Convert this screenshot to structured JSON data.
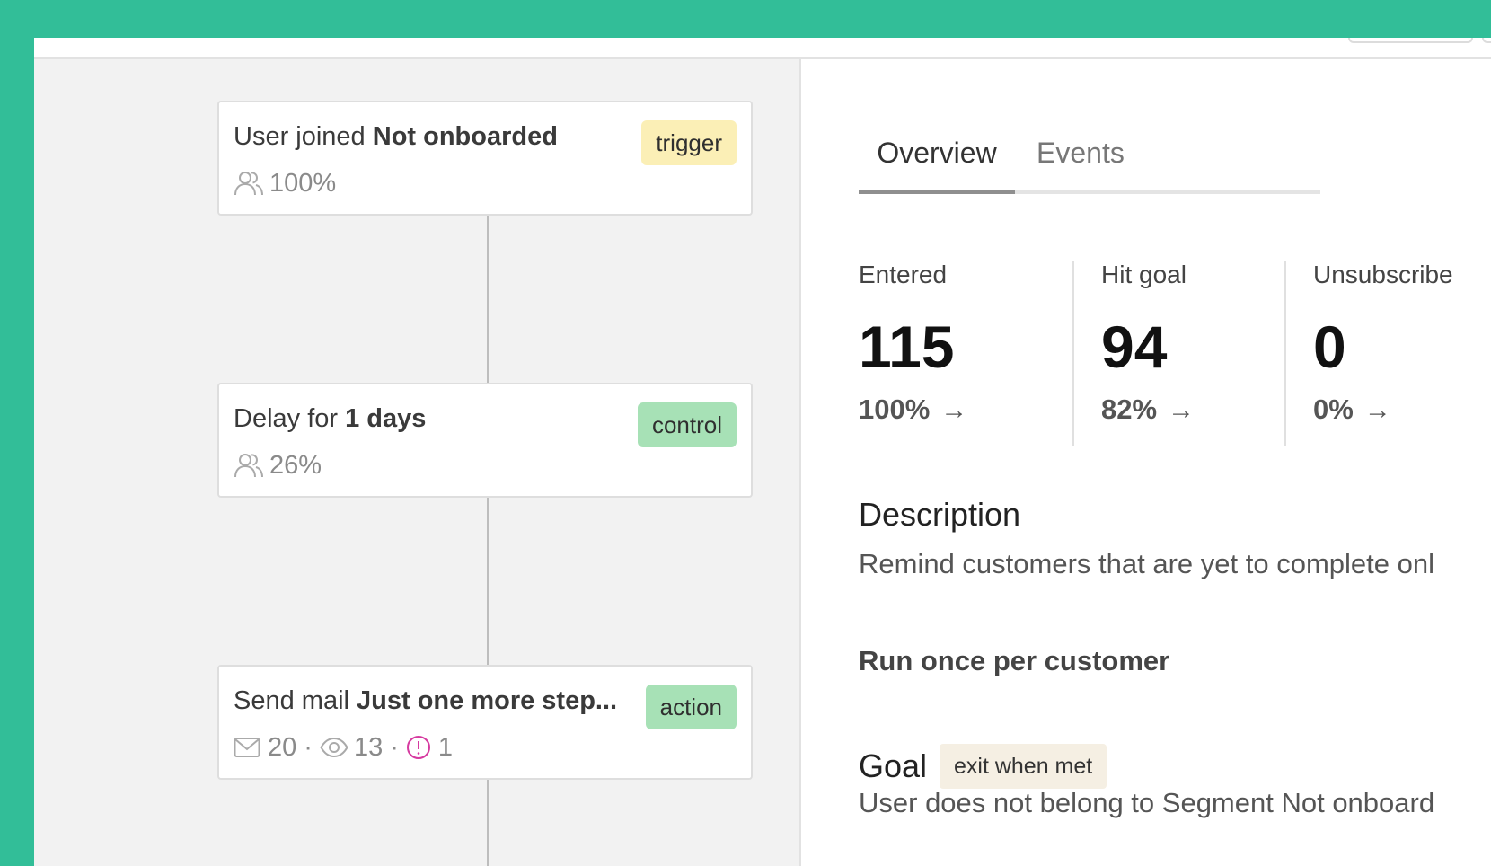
{
  "workflow": {
    "nodes": [
      {
        "prefix": "User joined",
        "name": "Not onboarded",
        "tag": "trigger",
        "icon": "users-icon",
        "percent": "100%"
      },
      {
        "prefix": "Delay for",
        "name": "1 days",
        "tag": "control",
        "icon": "users-icon",
        "percent": "26%"
      },
      {
        "prefix": "Send mail",
        "name": "Just one more step...",
        "tag": "action",
        "stats": {
          "sent": "20",
          "opened": "13",
          "errors": "1",
          "separator": "·"
        }
      }
    ]
  },
  "panel": {
    "tabs": [
      {
        "label": "Overview",
        "active": true
      },
      {
        "label": "Events",
        "active": false
      }
    ],
    "stats": [
      {
        "label": "Entered",
        "value": "115",
        "percent": "100%",
        "arrow": "→"
      },
      {
        "label": "Hit goal",
        "value": "94",
        "percent": "82%",
        "arrow": "→"
      },
      {
        "label": "Unsubscribe",
        "value": "0",
        "percent": "0%",
        "arrow": "→"
      }
    ],
    "description": {
      "title": "Description",
      "text": "Remind customers that are yet to complete onl"
    },
    "run_once": "Run once per customer",
    "goal": {
      "title": "Goal",
      "tag": "exit when met",
      "text": "User does not belong to Segment Not onboard"
    }
  },
  "colors": {
    "accent": "#32be98",
    "trigger_tag": "#fbefb6",
    "control_tag": "#a7e1b6",
    "action_tag": "#a7e1b6",
    "error_icon": "#d63aa0",
    "goal_tag": "#f5efe3"
  }
}
